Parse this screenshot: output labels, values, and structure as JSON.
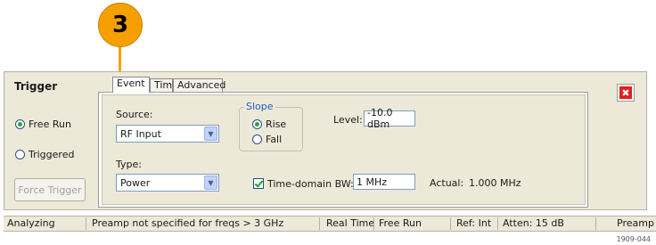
{
  "callout": {
    "number": "3",
    "color": "#f5a000"
  },
  "panel": {
    "title": "Trigger",
    "mode": {
      "options": [
        {
          "label": "Free Run",
          "selected": true
        },
        {
          "label": "Triggered",
          "selected": false
        }
      ]
    },
    "force_trigger_label": "Force Trigger"
  },
  "tabs": [
    {
      "label": "Event",
      "active": true
    },
    {
      "label": "Time",
      "active": false
    },
    {
      "label": "Advanced",
      "active": false
    }
  ],
  "event": {
    "source_label": "Source:",
    "source_value": "RF Input",
    "type_label": "Type:",
    "type_value": "Power",
    "slope": {
      "legend": "Slope",
      "options": [
        {
          "label": "Rise",
          "selected": true
        },
        {
          "label": "Fall",
          "selected": false
        }
      ]
    },
    "level_label": "Level:",
    "level_value": "-10.0 dBm",
    "time_domain_bw_label": "Time-domain BW:",
    "time_domain_bw_checked": true,
    "time_domain_bw_value": "1 MHz",
    "actual_label": "Actual:",
    "actual_value": "1.000 MHz"
  },
  "close_icon": "close-x-icon",
  "status_bar": {
    "state": "Analyzing",
    "message": "Preamp not specified for freqs > 3 GHz",
    "acquisition": "Real Time",
    "trigger": "Free Run",
    "reference": "Ref: Int",
    "attenuation": "Atten: 15 dB",
    "preamp": "Preamp"
  },
  "figure_id": "1909-044"
}
